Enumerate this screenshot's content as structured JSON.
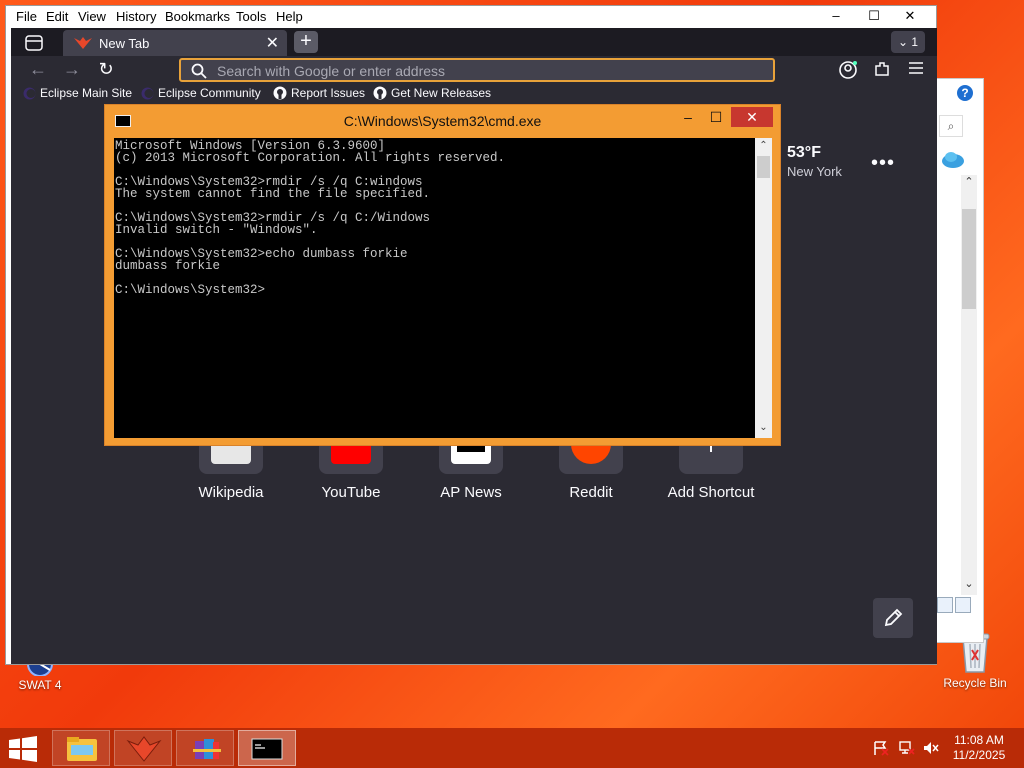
{
  "desktop": {
    "icons": [
      {
        "label": "SWAT 4"
      },
      {
        "label": "Recycle Bin"
      }
    ]
  },
  "bg_window": {
    "help_glyph": "?",
    "search_glyph": "⌕"
  },
  "browser": {
    "menu": [
      {
        "label": "File"
      },
      {
        "label": "Edit"
      },
      {
        "label": "View"
      },
      {
        "label": "History"
      },
      {
        "label": "Bookmarks"
      },
      {
        "label": "Tools"
      },
      {
        "label": "Help"
      }
    ],
    "window_controls": {
      "minimize": "–",
      "maximize": "☐",
      "close": "✕"
    },
    "tab": {
      "title": "New Tab",
      "close": "✕"
    },
    "new_tab_glyph": "+",
    "all_tabs_label": "1",
    "urlbar": {
      "placeholder": "Search with Google or enter address"
    },
    "bookmarks": [
      {
        "label": "Eclipse Main Site"
      },
      {
        "label": "Eclipse Community"
      },
      {
        "label": "Report Issues"
      },
      {
        "label": "Get New Releases"
      }
    ],
    "weather": {
      "temp": "53°F",
      "city": "New York"
    },
    "shortcuts": [
      {
        "label": "Wikipedia"
      },
      {
        "label": "YouTube"
      },
      {
        "label": "AP News"
      },
      {
        "label": "Reddit"
      },
      {
        "label": "Add Shortcut"
      }
    ],
    "colors": {
      "accent": "#e8a23a",
      "toolbar": "#2b2a33",
      "content": "#2b2a33"
    }
  },
  "cmd": {
    "title": "C:\\Windows\\System32\\cmd.exe",
    "controls": {
      "minimize": "–",
      "maximize": "☐",
      "close": "✕"
    },
    "lines": [
      "Microsoft Windows [Version 6.3.9600]",
      "(c) 2013 Microsoft Corporation. All rights reserved.",
      "",
      "C:\\Windows\\System32>rmdir /s /q C:windows",
      "The system cannot find the file specified.",
      "",
      "C:\\Windows\\System32>rmdir /s /q C:/Windows",
      "Invalid switch - \"Windows\".",
      "",
      "C:\\Windows\\System32>echo dumbass forkie",
      "dumbass forkie",
      "",
      "C:\\Windows\\System32>"
    ],
    "colors": {
      "frame": "#f39c33",
      "close": "#c7372f"
    }
  },
  "taskbar": {
    "clock": {
      "time": "11:08 AM",
      "date": "11/2/2025"
    },
    "color": "#b92b07"
  }
}
